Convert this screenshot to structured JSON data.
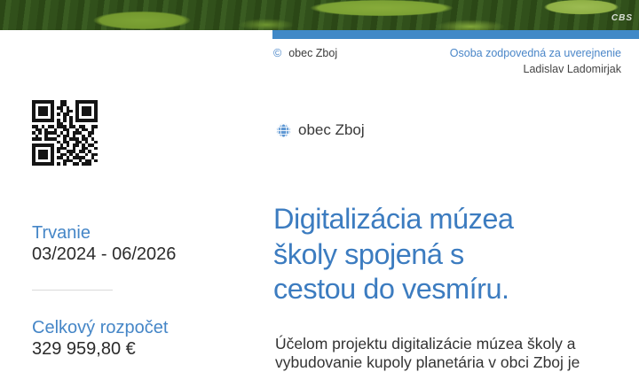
{
  "hero": {
    "watermark": "CBS"
  },
  "meta": {
    "copyright_symbol": "©",
    "copyright_owner": "obec Zboj",
    "responsible_label": "Osoba zodpovedná za uverejnenie",
    "responsible_name": "Ladislav Ladomirjak"
  },
  "sidebar": {
    "duration": {
      "label": "Trvanie",
      "value": "03/2024 - 06/2026"
    },
    "budget": {
      "label": "Celkový rozpočet",
      "value": "329 959,80 €"
    },
    "qr_matrix": [
      "111111100110001111111",
      "100000100110001000001",
      "101110101101001011101",
      "101110100101101011101",
      "101110101011001011101",
      "100000100010101000001",
      "111111101010101111111",
      "000000001100100000000",
      "110101101110110110011",
      "011010010011001011010",
      "101011110101011100110",
      "010010001011010010100",
      "111011110010111011010",
      "000000001011001101001",
      "111111100101011010110",
      "100000101110010011001",
      "101110101001110110100",
      "101110100110101001011",
      "101110101101011110010",
      "100000100011100101101",
      "111111101010011011100"
    ]
  },
  "main": {
    "site_name": "obec Zboj",
    "title_lines": [
      "Digitalizácia múzea",
      "školy spojená s",
      "cestou do vesmíru."
    ],
    "body_lines": [
      "Účelom projektu digitalizácie múzea školy a",
      "vybudovanie kupoly planetária v obci Zboj je"
    ]
  },
  "colors": {
    "accent_blue": "#4189c7",
    "heading_blue": "#3c7cc0",
    "label_blue": "#4586c7",
    "text_dark": "#333333"
  }
}
